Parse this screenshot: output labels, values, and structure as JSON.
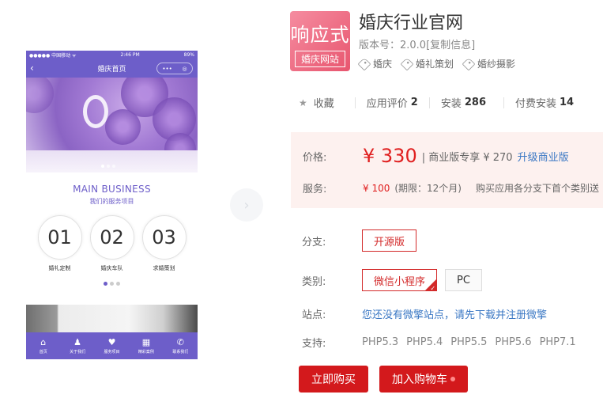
{
  "phone": {
    "status_carrier": "●●●●● 中国移动 ᯤ",
    "status_time": "2:46 PM",
    "status_battery": "89%",
    "nav_title": "婚庆首页",
    "nav_back": "‹",
    "nav_more": "•••",
    "nav_close": "◎",
    "business_title": "MAIN BUSINESS",
    "business_subtitle": "我们的服务项目",
    "services": [
      {
        "num": "01",
        "label": "婚礼定制"
      },
      {
        "num": "02",
        "label": "婚庆车队"
      },
      {
        "num": "03",
        "label": "求婚策划"
      }
    ],
    "tabs": [
      {
        "icon": "⌂",
        "label": "首页"
      },
      {
        "icon": "♟",
        "label": "关于我们"
      },
      {
        "icon": "♥",
        "label": "服务项目"
      },
      {
        "icon": "▦",
        "label": "精彩案例"
      },
      {
        "icon": "✆",
        "label": "联系我们"
      }
    ]
  },
  "carousel": {
    "next_icon": "›"
  },
  "product": {
    "logo_big": "响应式",
    "logo_small": "婚庆网站",
    "title": "婚庆行业官网",
    "version": "版本号：2.0.0[复制信息]",
    "tags": [
      "婚庆",
      "婚礼策划",
      "婚纱摄影"
    ]
  },
  "stats": {
    "favorite_icon": "★",
    "favorite": "收藏",
    "rating_label": "应用评价",
    "rating_value": "2",
    "install_label": "安装",
    "install_value": "286",
    "paid_label": "付费安装",
    "paid_value": "14"
  },
  "pricing": {
    "price_label": "价格:",
    "price": "¥ 330",
    "price_extra": "| 商业版专享 ¥ 270",
    "upgrade": "升级商业版",
    "service_label": "服务:",
    "service_price": "¥ 100",
    "service_period": "(期限：12个月)",
    "service_note": "购买应用各分支下首个类别送"
  },
  "options": {
    "branch_label": "分支:",
    "branch_value": "开源版",
    "category_label": "类别:",
    "category_options": [
      "微信小程序",
      "PC"
    ],
    "site_label": "站点:",
    "site_text": "您还没有微擎站点，请先下载并注册微擎",
    "support_label": "支持:",
    "php_versions": [
      "PHP5.3",
      "PHP5.4",
      "PHP5.5",
      "PHP5.6",
      "PHP7.1"
    ]
  },
  "actions": {
    "buy": "立即购买",
    "cart": "加入购物车"
  },
  "colors": {
    "theme_purple": "#6d5ec9",
    "accent_red": "#d3191c",
    "link_blue": "#3b78c4",
    "price_bg": "#fdf1ef"
  }
}
